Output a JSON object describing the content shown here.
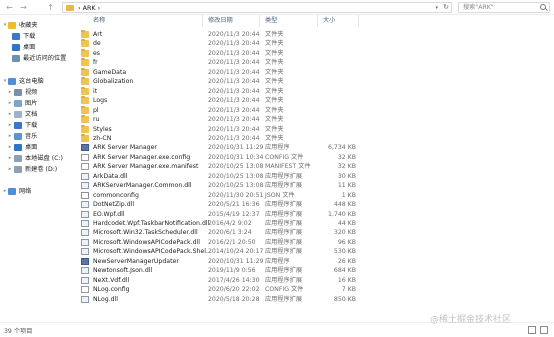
{
  "address": {
    "back": "←",
    "forward": "→",
    "up": "↑",
    "path": "ARK",
    "separator": "›",
    "dropdown": "▾",
    "refresh": "↻",
    "search_placeholder": "搜索\"ARK\""
  },
  "nav": {
    "quick_access": "收藏夹",
    "download": "下载",
    "desktop": "桌面",
    "recent": "最近访问的位置",
    "this_pc": "这台电脑",
    "videos": "视频",
    "pictures": "图片",
    "documents": "文档",
    "downloads": "下载",
    "music": "音乐",
    "desktop2": "桌面",
    "local_disk": "本地磁盘 (C:)",
    "new_volume": "新建卷 (D:)",
    "network": "网络"
  },
  "columns": {
    "name": "名称",
    "date": "修改日期",
    "type": "类型",
    "size": "大小"
  },
  "files": [
    {
      "name": "Art",
      "date": "2020/11/3 20:44",
      "type": "文件夹",
      "size": "",
      "icon": "folder"
    },
    {
      "name": "de",
      "date": "2020/11/3 20:44",
      "type": "文件夹",
      "size": "",
      "icon": "folder"
    },
    {
      "name": "es",
      "date": "2020/11/3 20:44",
      "type": "文件夹",
      "size": "",
      "icon": "folder"
    },
    {
      "name": "fr",
      "date": "2020/11/3 20:44",
      "type": "文件夹",
      "size": "",
      "icon": "folder"
    },
    {
      "name": "GameData",
      "date": "2020/11/3 20:44",
      "type": "文件夹",
      "size": "",
      "icon": "folder"
    },
    {
      "name": "Globalization",
      "date": "2020/11/3 20:44",
      "type": "文件夹",
      "size": "",
      "icon": "folder"
    },
    {
      "name": "it",
      "date": "2020/11/3 20:44",
      "type": "文件夹",
      "size": "",
      "icon": "folder"
    },
    {
      "name": "Logs",
      "date": "2020/11/3 20:44",
      "type": "文件夹",
      "size": "",
      "icon": "folder"
    },
    {
      "name": "pl",
      "date": "2020/11/3 20:44",
      "type": "文件夹",
      "size": "",
      "icon": "folder"
    },
    {
      "name": "ru",
      "date": "2020/11/3 20:44",
      "type": "文件夹",
      "size": "",
      "icon": "folder"
    },
    {
      "name": "Styles",
      "date": "2020/11/3 20:44",
      "type": "文件夹",
      "size": "",
      "icon": "folder"
    },
    {
      "name": "zh-CN",
      "date": "2020/11/3 20:44",
      "type": "文件夹",
      "size": "",
      "icon": "folder"
    },
    {
      "name": "ARK Server Manager",
      "date": "2020/10/31 11:29",
      "type": "应用程序",
      "size": "6,734 KB",
      "icon": "exe"
    },
    {
      "name": "ARK Server Manager.exe.config",
      "date": "2020/10/31 10:34",
      "type": "CONFIG 文件",
      "size": "32 KB",
      "icon": "cfg"
    },
    {
      "name": "ARK Server Manager.exe.manifest",
      "date": "2020/10/25 13:08",
      "type": "MANIFEST 文件",
      "size": "32 KB",
      "icon": "cfg"
    },
    {
      "name": "ArkData.dll",
      "date": "2020/10/25 13:08",
      "type": "应用程序扩展",
      "size": "30 KB",
      "icon": "dll"
    },
    {
      "name": "ARKServerManager.Common.dll",
      "date": "2020/10/25 13:08",
      "type": "应用程序扩展",
      "size": "11 KB",
      "icon": "dll"
    },
    {
      "name": "commonconfig",
      "date": "2020/11/30 20:51",
      "type": "JSON 文件",
      "size": "1 KB",
      "icon": "json"
    },
    {
      "name": "DotNetZip.dll",
      "date": "2020/5/21 16:36",
      "type": "应用程序扩展",
      "size": "448 KB",
      "icon": "dll"
    },
    {
      "name": "EO.Wpf.dll",
      "date": "2015/4/19 12:37",
      "type": "应用程序扩展",
      "size": "1,740 KB",
      "icon": "dll"
    },
    {
      "name": "Hardcodet.Wpf.TaskbarNotification.dll",
      "date": "2016/4/2 9:02",
      "type": "应用程序扩展",
      "size": "44 KB",
      "icon": "dll"
    },
    {
      "name": "Microsoft.Win32.TaskScheduler.dll",
      "date": "2020/6/1 3:24",
      "type": "应用程序扩展",
      "size": "320 KB",
      "icon": "dll"
    },
    {
      "name": "Microsoft.WindowsAPICodePack.dll",
      "date": "2016/2/1 20:50",
      "type": "应用程序扩展",
      "size": "96 KB",
      "icon": "dll"
    },
    {
      "name": "Microsoft.WindowsAPICodePack.Shel...",
      "date": "2014/10/24 20:17",
      "type": "应用程序扩展",
      "size": "530 KB",
      "icon": "dll"
    },
    {
      "name": "NewServerManagerUpdater",
      "date": "2020/10/31 11:29",
      "type": "应用程序",
      "size": "26 KB",
      "icon": "exe"
    },
    {
      "name": "Newtonsoft.Json.dll",
      "date": "2019/11/9 0:56",
      "type": "应用程序扩展",
      "size": "684 KB",
      "icon": "dll"
    },
    {
      "name": "NeXt.Vdf.dll",
      "date": "2017/4/26 14:30",
      "type": "应用程序扩展",
      "size": "16 KB",
      "icon": "dll"
    },
    {
      "name": "NLog.config",
      "date": "2020/6/20 22:02",
      "type": "CONFIG 文件",
      "size": "7 KB",
      "icon": "cfg"
    },
    {
      "name": "NLog.dll",
      "date": "2020/5/18 20:28",
      "type": "应用程序扩展",
      "size": "850 KB",
      "icon": "dll"
    }
  ],
  "status": {
    "count": "39 个项目"
  },
  "watermark": "@稀土掘金技术社区",
  "colors": {
    "header_text": "#4d6082",
    "folder": "#f0c355",
    "exe": "#5a76a8"
  }
}
